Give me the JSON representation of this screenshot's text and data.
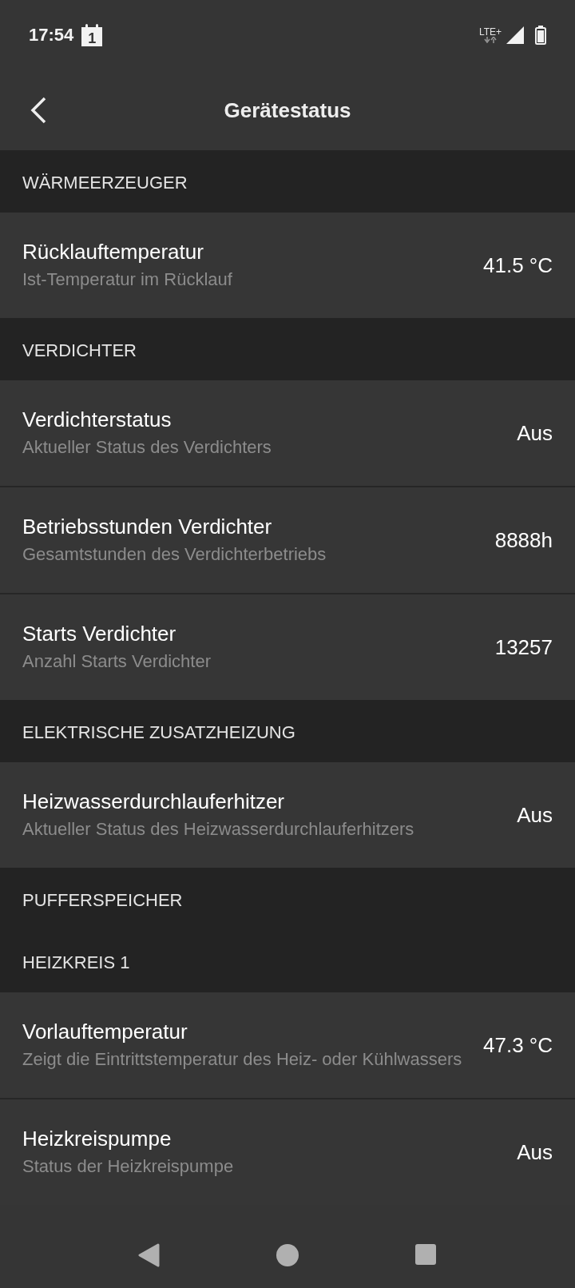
{
  "status_bar": {
    "time": "17:54",
    "calendar_day": "1",
    "network": "LTE+"
  },
  "app_bar": {
    "title": "Gerätestatus"
  },
  "sections": [
    {
      "title": "WÄRMEERZEUGER",
      "items": [
        {
          "title": "Rücklauftemperatur",
          "subtitle": "Ist-Temperatur im Rücklauf",
          "value": "41.5 °C"
        }
      ]
    },
    {
      "title": "VERDICHTER",
      "items": [
        {
          "title": "Verdichterstatus",
          "subtitle": "Aktueller Status des Verdichters",
          "value": "Aus"
        },
        {
          "title": "Betriebsstunden Verdichter",
          "subtitle": "Gesamtstunden des Verdichterbetriebs",
          "value": "8888h"
        },
        {
          "title": "Starts Verdichter",
          "subtitle": "Anzahl Starts Verdichter",
          "value": "13257"
        }
      ]
    },
    {
      "title": "ELEKTRISCHE ZUSATZHEIZUNG",
      "items": [
        {
          "title": "Heizwasserdurchlauferhitzer",
          "subtitle": "Aktueller Status des Heizwasserdurchlauferhitzers",
          "value": "Aus"
        }
      ]
    },
    {
      "title": "PUFFERSPEICHER"
    },
    {
      "title": "HEIZKREIS 1",
      "items": [
        {
          "title": "Vorlauftemperatur",
          "subtitle": "Zeigt die Eintrittstemperatur des Heiz- oder Kühlwassers",
          "value": "47.3 °C"
        },
        {
          "title": "Heizkreispumpe",
          "subtitle": "Status der Heizkreispumpe",
          "value": "Aus"
        }
      ]
    }
  ]
}
